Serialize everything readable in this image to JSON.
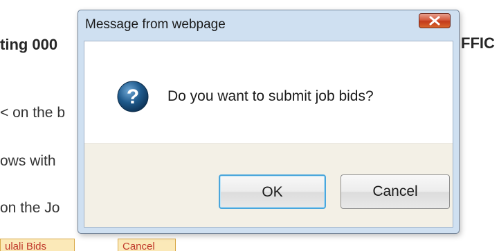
{
  "background": {
    "heading_left": "ting  000",
    "heading_right": "FFIC",
    "line1": "< on the b",
    "line2": "ows with",
    "line3": "on the Jo",
    "button_left": "ulali Bids",
    "button_right": "Cancel"
  },
  "dialog": {
    "title": "Message from webpage",
    "message": "Do you want to submit job bids?",
    "icon": "question-icon",
    "ok_label": "OK",
    "cancel_label": "Cancel",
    "close_icon": "close-icon"
  },
  "colors": {
    "dialog_frame": "#cfe0f1",
    "close_button": "#c33a1c",
    "ok_focus_border": "#4aa6dc",
    "button_area": "#f3f0e6",
    "question_icon": "#1f5a8c"
  }
}
